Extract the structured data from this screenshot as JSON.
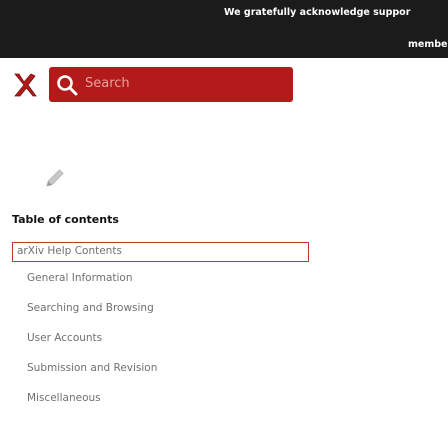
{
  "header": {
    "acknowledgement": "We gratefully acknowledge suppor",
    "member_text": "member in"
  },
  "search": {
    "label": "Search",
    "accent_color": "#b31b1b"
  },
  "toc": {
    "title": "Table of contents",
    "root_item": "arXiv Help Contents",
    "items": [
      "General Information",
      "Searching and Browsing",
      "User Accounts",
      "Submission and Revision",
      "Miscellaneous"
    ]
  },
  "icons": {
    "logo": "arxiv-logo-icon",
    "search": "search-icon",
    "edit": "pencil-icon"
  }
}
